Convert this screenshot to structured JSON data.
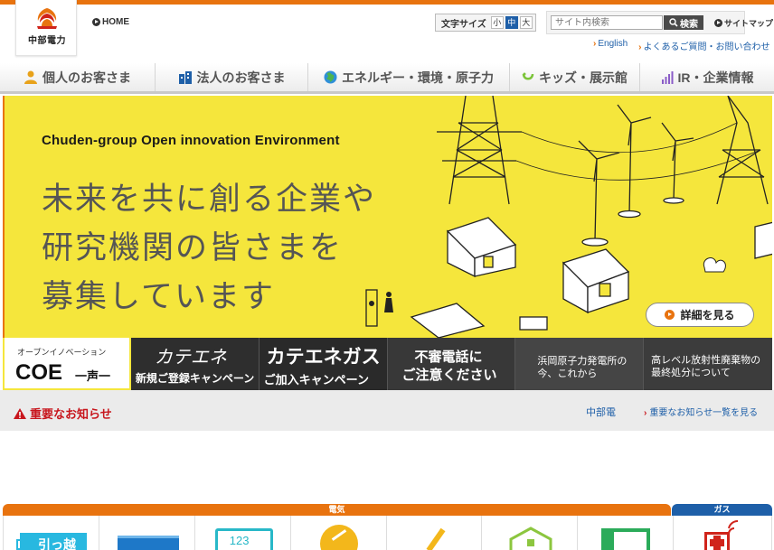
{
  "header": {
    "logo_text": "中部電力",
    "home_label": "HOME",
    "text_size": {
      "label": "文字サイズ",
      "options": [
        "小",
        "中",
        "大"
      ]
    },
    "search": {
      "placeholder": "サイト内検索",
      "button": "検索"
    },
    "sitemap_label": "サイトマップ",
    "sub_links": [
      "English",
      "よくあるご質問・お問い合わせ"
    ]
  },
  "nav": {
    "items": [
      {
        "label": "個人のお客さま",
        "icon": "person-icon"
      },
      {
        "label": "法人のお客さま",
        "icon": "building-icon"
      },
      {
        "label": "エネルギー・環境・原子力",
        "icon": "globe-icon"
      },
      {
        "label": "キッズ・展示館",
        "icon": "kids-icon"
      },
      {
        "label": "IR・企業情報",
        "icon": "bar-chart-icon"
      }
    ]
  },
  "hero": {
    "title": "Chuden-group Open innovation Environment",
    "lines": [
      "未来を共に創る企業や",
      "研究機関の皆さまを",
      "募集しています"
    ],
    "detail_button": "詳細を見る"
  },
  "banners": {
    "coe": {
      "top": "オープンイノベーション",
      "main": "COE",
      "sub": "一声一"
    },
    "katene_reg": {
      "script": "カテエネ",
      "sub": "新規ご登録キャンペーン"
    },
    "katene_gas": {
      "main": "カテエネガス",
      "sub": "ご加入キャンペーン"
    },
    "fraud_call": {
      "line1": "不審電話に",
      "line2": "ご注意ください"
    },
    "hamaoka": {
      "line1": "浜岡原子力発電所の",
      "line2": "今、これから"
    },
    "waste": {
      "line1": "高レベル放射性廃棄物の",
      "line2": "最終処分について"
    }
  },
  "notices": {
    "label": "重要なお知らせ",
    "text": "中部電",
    "more": "重要なお知らせ一覧を見る"
  },
  "services": {
    "denki_label": "電気",
    "gas_label": "ガス",
    "tile_texts": [
      "引っ越",
      "123"
    ]
  },
  "colors": {
    "brand_orange": "#e8730f",
    "hero_yellow": "#f5e63c",
    "link_blue": "#1e5fa8",
    "alert_red": "#c8161d"
  }
}
